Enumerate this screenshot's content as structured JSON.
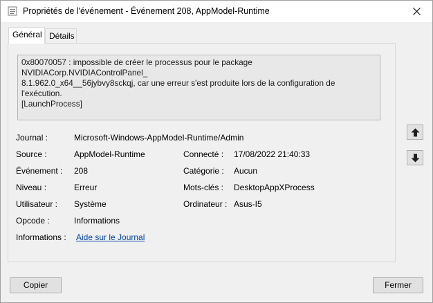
{
  "window": {
    "title": "Propriétés de l'événement - Événement 208, AppModel-Runtime"
  },
  "tabs": [
    {
      "label": "Général",
      "active": true
    },
    {
      "label": "Détails",
      "active": false
    }
  ],
  "description": "0x80070057 : impossible de créer le processus pour le package NVIDIACorp.NVIDIAControlPanel_\n8.1.962.0_x64__56jybvy8sckqj, car une erreur s'est produite lors de la configuration de l'exécution.\n[LaunchProcess]",
  "fields": {
    "journal": {
      "label": "Journal :",
      "value": "Microsoft-Windows-AppModel-Runtime/Admin"
    },
    "source": {
      "label": "Source :",
      "value": "AppModel-Runtime"
    },
    "connecte": {
      "label": "Connecté :",
      "value": "17/08/2022 21:40:33"
    },
    "evenement": {
      "label": "Événement :",
      "value": "208"
    },
    "categorie": {
      "label": "Catégorie :",
      "value": "Aucun"
    },
    "niveau": {
      "label": "Niveau :",
      "value": "Erreur"
    },
    "mots_cles": {
      "label": "Mots-clés :",
      "value": "DesktopAppXProcess"
    },
    "utilisateur": {
      "label": "Utilisateur :",
      "value": "Système"
    },
    "ordinateur": {
      "label": "Ordinateur :",
      "value": "Asus-I5"
    },
    "opcode": {
      "label": "Opcode :",
      "value": "Informations"
    },
    "informations": {
      "label": "Informations :",
      "value": "Aide sur le Journal"
    }
  },
  "buttons": {
    "copy": "Copier",
    "close": "Fermer"
  },
  "icons": {
    "app": "event-properties-icon",
    "close": "close-icon",
    "up": "arrow-up-icon",
    "down": "arrow-down-icon"
  }
}
